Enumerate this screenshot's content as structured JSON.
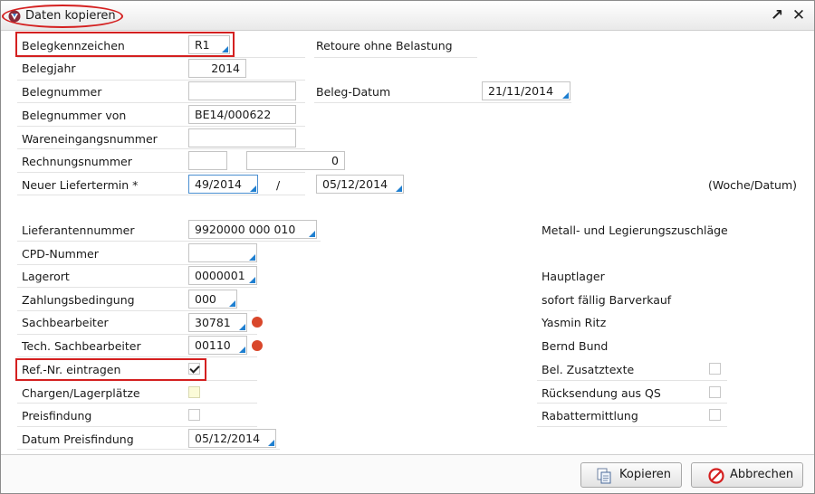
{
  "window": {
    "title": "Daten kopieren"
  },
  "form": {
    "belegkennzeichen": {
      "label": "Belegkennzeichen",
      "value": "R1",
      "info": "Retoure ohne Belastung"
    },
    "belegjahr": {
      "label": "Belegjahr",
      "value": "2014"
    },
    "belegnummer": {
      "label": "Belegnummer",
      "value": ""
    },
    "beleg_datum": {
      "label": "Beleg-Datum",
      "value": "21/11/2014"
    },
    "belegnummer_von": {
      "label": "Belegnummer von",
      "value": "BE14/000622"
    },
    "wareneingangsnummer": {
      "label": "Wareneingangsnummer",
      "value": ""
    },
    "rechnungsnummer": {
      "label": "Rechnungsnummer",
      "value1": "",
      "value2": "0"
    },
    "neuer_liefertermin": {
      "label": "Neuer Liefertermin *",
      "week": "49/2014",
      "separator": "/",
      "date": "05/12/2014",
      "hint": "(Woche/Datum)"
    },
    "lieferantennummer": {
      "label": "Lieferantennummer",
      "value": "9920000 000 010",
      "info": "Metall- und Legierungszuschläge"
    },
    "cpd_nummer": {
      "label": "CPD-Nummer",
      "value": ""
    },
    "lagerort": {
      "label": "Lagerort",
      "value": "0000001",
      "info": "Hauptlager"
    },
    "zahlungsbedingung": {
      "label": "Zahlungsbedingung",
      "value": "000",
      "info": "sofort fällig Barverkauf"
    },
    "sachbearbeiter": {
      "label": "Sachbearbeiter",
      "value": "30781",
      "info": "Yasmin Ritz"
    },
    "tech_sachbearbeiter": {
      "label": "Tech. Sachbearbeiter",
      "value": "00110",
      "info": "Bernd Bund"
    },
    "ref_nr_eintragen": {
      "label": "Ref.-Nr. eintragen",
      "checked": true
    },
    "chargen_lagerplaetze": {
      "label": "Chargen/Lagerplätze",
      "checked": false
    },
    "preisfindung": {
      "label": "Preisfindung",
      "checked": false
    },
    "datum_preisfindung": {
      "label": "Datum Preisfindung",
      "value": "05/12/2014"
    },
    "bel_zusatztexte": {
      "label": "Bel. Zusatztexte",
      "checked": false
    },
    "ruecksendung_aus_qs": {
      "label": "Rücksendung aus QS",
      "checked": false
    },
    "rabattermittlung": {
      "label": "Rabattermittlung",
      "checked": false
    }
  },
  "buttons": {
    "copy": "Kopieren",
    "cancel": "Abbrechen"
  },
  "icons": {
    "maximize": "expand-arrow-icon",
    "close": "close-icon",
    "app": "app-logo-icon",
    "copy": "copy-documents-icon",
    "cancel": "no-entry-icon"
  },
  "colors": {
    "accent": "#1f7fd0",
    "highlight_box": "#d42020",
    "status_dot": "#d9472b"
  }
}
